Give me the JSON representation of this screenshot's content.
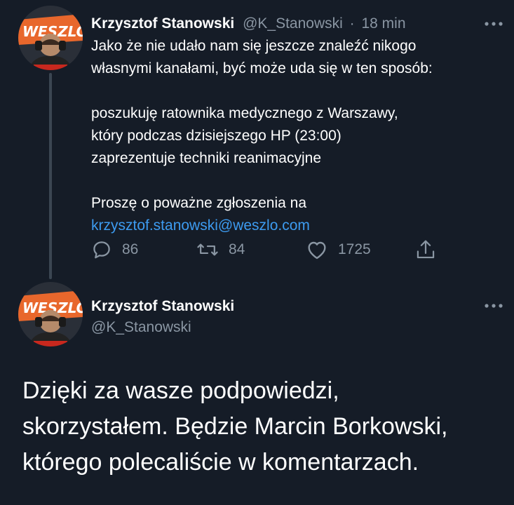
{
  "colors": {
    "background": "#151c27",
    "muted": "#8a96a3",
    "link": "#3d9bf0",
    "thread": "#3b4652"
  },
  "tweet1": {
    "author_name": "Krzysztof Stanowski",
    "author_handle": "@K_Stanowski",
    "separator": "·",
    "time": "18 min",
    "more_icon": "more-horizontal-icon",
    "lines_par1": [
      "Jako że nie udało nam się jeszcze znaleźć nikogo",
      "własnymi kanałami, być może uda się w ten sposób:"
    ],
    "lines_par2": [
      "poszukuję ratownika medycznego z Warszawy,",
      "który podczas dzisiejszego HP (23:00)",
      "zaprezentuje techniki reanimacyjne"
    ],
    "line_par3": "Proszę o poważne zgłoszenia na",
    "email": "krzysztof.stanowski@weszlo.com",
    "actions": {
      "reply_icon": "reply-icon",
      "reply_count": "86",
      "retweet_icon": "retweet-icon",
      "retweet_count": "84",
      "like_icon": "heart-icon",
      "like_count": "1725",
      "share_icon": "share-icon"
    }
  },
  "tweet2": {
    "author_name": "Krzysztof Stanowski",
    "author_handle": "@K_Stanowski",
    "more_icon": "more-horizontal-icon",
    "lines": [
      "Dzięki za wasze podpowiedzi,",
      "skorzystałem. Będzie Marcin Borkowski,",
      "którego polecaliście w komentarzach."
    ]
  }
}
